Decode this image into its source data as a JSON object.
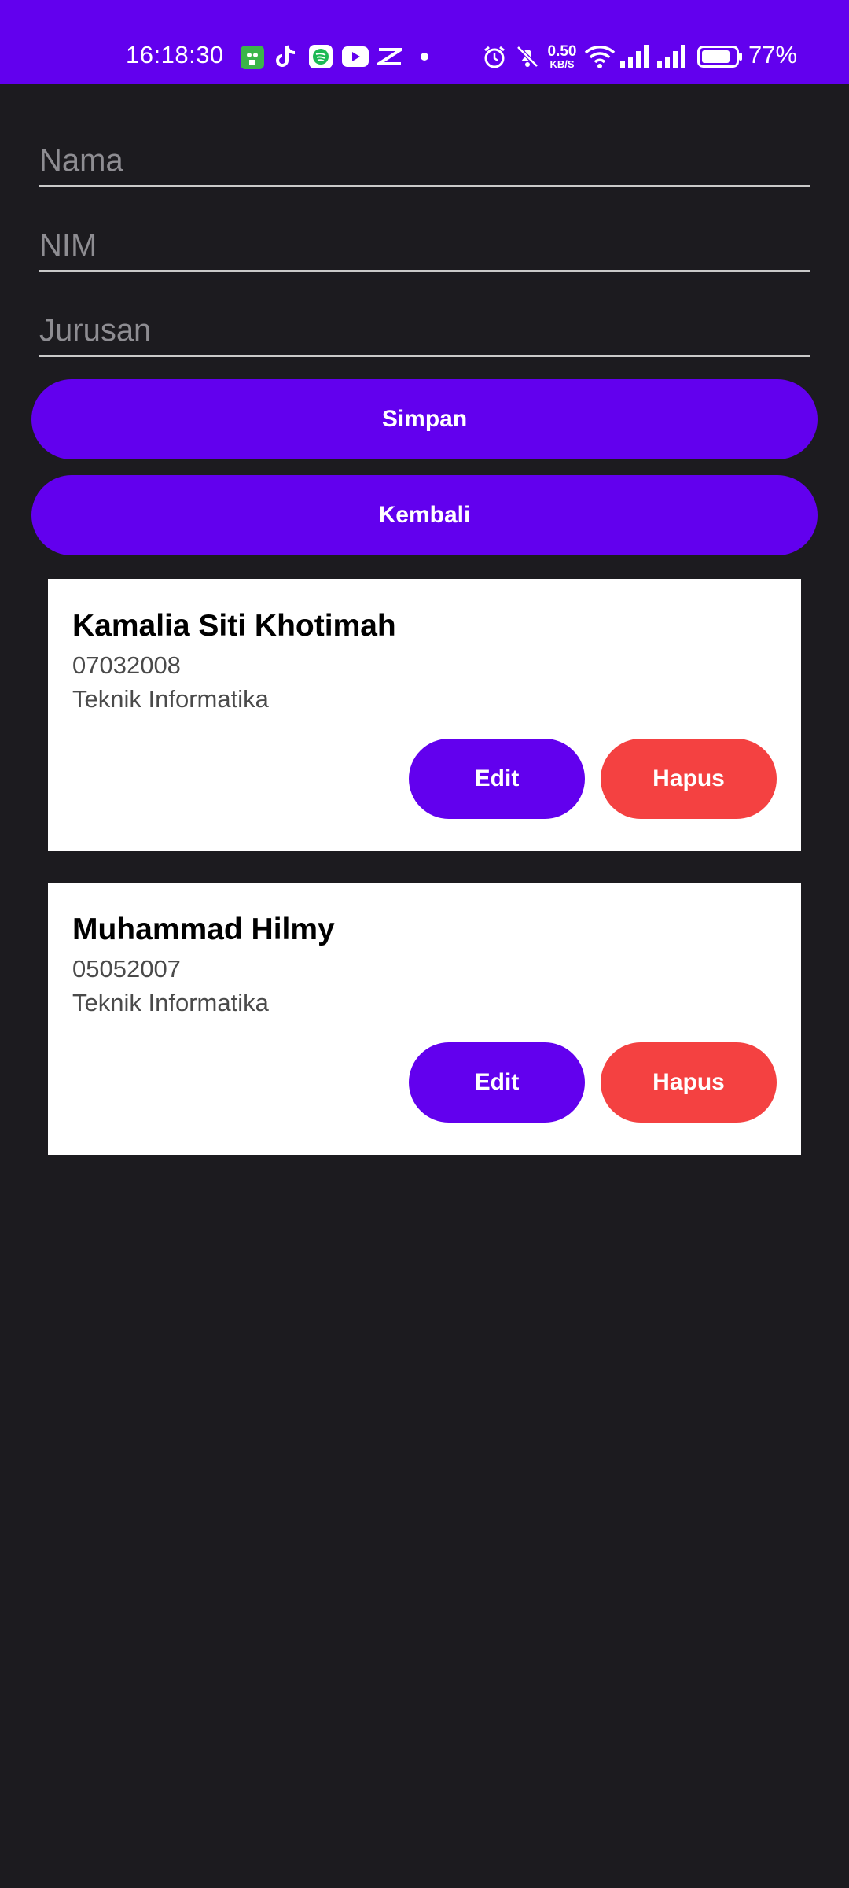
{
  "status_bar": {
    "time": "16:18:30",
    "net_speed_value": "0.50",
    "net_speed_unit": "KB/S",
    "battery_percent": "77%",
    "icons": [
      "tokopedia-icon",
      "tiktok-icon",
      "spotify-icon",
      "youtube-icon",
      "capcut-icon",
      "dot-icon",
      "alarm-icon",
      "mute-icon",
      "wifi-icon",
      "signal-icon",
      "signal-icon",
      "battery-icon"
    ]
  },
  "form": {
    "nama_placeholder": "Nama",
    "nim_placeholder": "NIM",
    "jurusan_placeholder": "Jurusan",
    "simpan_label": "Simpan",
    "kembali_label": "Kembali"
  },
  "students": [
    {
      "name": "Kamalia Siti Khotimah",
      "nim": "07032008",
      "jurusan": "Teknik Informatika",
      "edit_label": "Edit",
      "hapus_label": "Hapus"
    },
    {
      "name": "Muhammad Hilmy",
      "nim": "05052007",
      "jurusan": "Teknik Informatika",
      "edit_label": "Edit",
      "hapus_label": "Hapus"
    }
  ],
  "colors": {
    "primary": "#6200ee",
    "danger": "#f44141",
    "background": "#1c1b1f",
    "card": "#ffffff"
  }
}
